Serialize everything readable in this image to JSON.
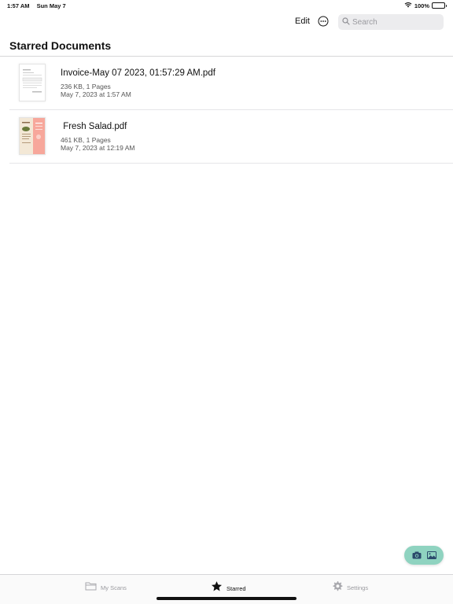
{
  "status_bar": {
    "time": "1:57 AM",
    "date": "Sun May 7",
    "battery": "100%"
  },
  "toolbar": {
    "edit_label": "Edit",
    "more_icon": "ellipsis-circle-icon",
    "search_placeholder": "Search"
  },
  "page": {
    "title": "Starred Documents"
  },
  "documents": [
    {
      "name": "Invoice-May 07 2023, 01:57:29 AM.pdf",
      "size_pages": "236 KB, 1 Pages",
      "date": "May 7, 2023 at 1:57 AM"
    },
    {
      "name": " Fresh Salad.pdf",
      "size_pages": "461 KB, 1 Pages",
      "date": "May 7, 2023 at 12:19 AM"
    }
  ],
  "fab": {
    "camera_icon": "camera-icon",
    "photo_icon": "photo-icon",
    "color": "#8fd3c0"
  },
  "tabs": [
    {
      "label": "My Scans",
      "icon": "folder-icon",
      "active": false
    },
    {
      "label": "Starred",
      "icon": "star-icon",
      "active": true
    },
    {
      "label": "Settings",
      "icon": "gear-icon",
      "active": false
    }
  ]
}
